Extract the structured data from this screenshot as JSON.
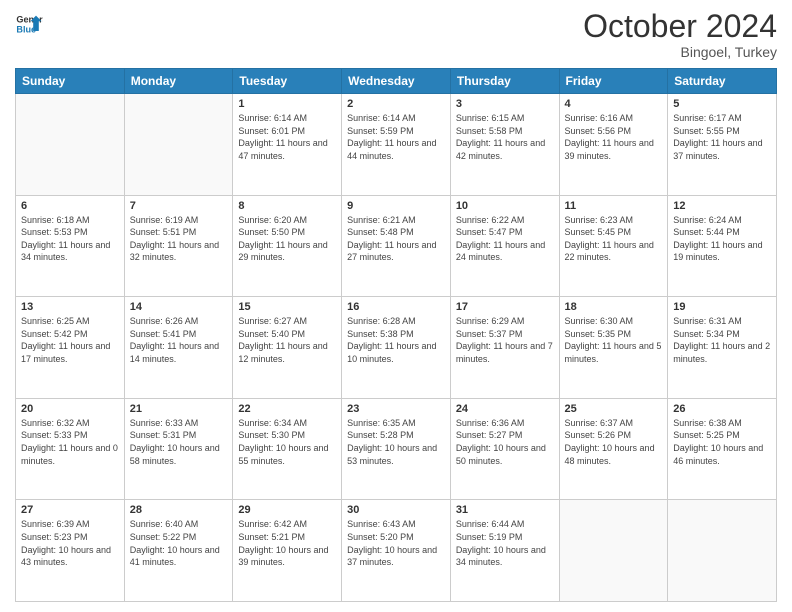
{
  "header": {
    "logo_line1": "General",
    "logo_line2": "Blue",
    "month": "October 2024",
    "location": "Bingoel, Turkey"
  },
  "weekdays": [
    "Sunday",
    "Monday",
    "Tuesday",
    "Wednesday",
    "Thursday",
    "Friday",
    "Saturday"
  ],
  "weeks": [
    [
      {
        "day": "",
        "sunrise": "",
        "sunset": "",
        "daylight": ""
      },
      {
        "day": "",
        "sunrise": "",
        "sunset": "",
        "daylight": ""
      },
      {
        "day": "1",
        "sunrise": "Sunrise: 6:14 AM",
        "sunset": "Sunset: 6:01 PM",
        "daylight": "Daylight: 11 hours and 47 minutes."
      },
      {
        "day": "2",
        "sunrise": "Sunrise: 6:14 AM",
        "sunset": "Sunset: 5:59 PM",
        "daylight": "Daylight: 11 hours and 44 minutes."
      },
      {
        "day": "3",
        "sunrise": "Sunrise: 6:15 AM",
        "sunset": "Sunset: 5:58 PM",
        "daylight": "Daylight: 11 hours and 42 minutes."
      },
      {
        "day": "4",
        "sunrise": "Sunrise: 6:16 AM",
        "sunset": "Sunset: 5:56 PM",
        "daylight": "Daylight: 11 hours and 39 minutes."
      },
      {
        "day": "5",
        "sunrise": "Sunrise: 6:17 AM",
        "sunset": "Sunset: 5:55 PM",
        "daylight": "Daylight: 11 hours and 37 minutes."
      }
    ],
    [
      {
        "day": "6",
        "sunrise": "Sunrise: 6:18 AM",
        "sunset": "Sunset: 5:53 PM",
        "daylight": "Daylight: 11 hours and 34 minutes."
      },
      {
        "day": "7",
        "sunrise": "Sunrise: 6:19 AM",
        "sunset": "Sunset: 5:51 PM",
        "daylight": "Daylight: 11 hours and 32 minutes."
      },
      {
        "day": "8",
        "sunrise": "Sunrise: 6:20 AM",
        "sunset": "Sunset: 5:50 PM",
        "daylight": "Daylight: 11 hours and 29 minutes."
      },
      {
        "day": "9",
        "sunrise": "Sunrise: 6:21 AM",
        "sunset": "Sunset: 5:48 PM",
        "daylight": "Daylight: 11 hours and 27 minutes."
      },
      {
        "day": "10",
        "sunrise": "Sunrise: 6:22 AM",
        "sunset": "Sunset: 5:47 PM",
        "daylight": "Daylight: 11 hours and 24 minutes."
      },
      {
        "day": "11",
        "sunrise": "Sunrise: 6:23 AM",
        "sunset": "Sunset: 5:45 PM",
        "daylight": "Daylight: 11 hours and 22 minutes."
      },
      {
        "day": "12",
        "sunrise": "Sunrise: 6:24 AM",
        "sunset": "Sunset: 5:44 PM",
        "daylight": "Daylight: 11 hours and 19 minutes."
      }
    ],
    [
      {
        "day": "13",
        "sunrise": "Sunrise: 6:25 AM",
        "sunset": "Sunset: 5:42 PM",
        "daylight": "Daylight: 11 hours and 17 minutes."
      },
      {
        "day": "14",
        "sunrise": "Sunrise: 6:26 AM",
        "sunset": "Sunset: 5:41 PM",
        "daylight": "Daylight: 11 hours and 14 minutes."
      },
      {
        "day": "15",
        "sunrise": "Sunrise: 6:27 AM",
        "sunset": "Sunset: 5:40 PM",
        "daylight": "Daylight: 11 hours and 12 minutes."
      },
      {
        "day": "16",
        "sunrise": "Sunrise: 6:28 AM",
        "sunset": "Sunset: 5:38 PM",
        "daylight": "Daylight: 11 hours and 10 minutes."
      },
      {
        "day": "17",
        "sunrise": "Sunrise: 6:29 AM",
        "sunset": "Sunset: 5:37 PM",
        "daylight": "Daylight: 11 hours and 7 minutes."
      },
      {
        "day": "18",
        "sunrise": "Sunrise: 6:30 AM",
        "sunset": "Sunset: 5:35 PM",
        "daylight": "Daylight: 11 hours and 5 minutes."
      },
      {
        "day": "19",
        "sunrise": "Sunrise: 6:31 AM",
        "sunset": "Sunset: 5:34 PM",
        "daylight": "Daylight: 11 hours and 2 minutes."
      }
    ],
    [
      {
        "day": "20",
        "sunrise": "Sunrise: 6:32 AM",
        "sunset": "Sunset: 5:33 PM",
        "daylight": "Daylight: 11 hours and 0 minutes."
      },
      {
        "day": "21",
        "sunrise": "Sunrise: 6:33 AM",
        "sunset": "Sunset: 5:31 PM",
        "daylight": "Daylight: 10 hours and 58 minutes."
      },
      {
        "day": "22",
        "sunrise": "Sunrise: 6:34 AM",
        "sunset": "Sunset: 5:30 PM",
        "daylight": "Daylight: 10 hours and 55 minutes."
      },
      {
        "day": "23",
        "sunrise": "Sunrise: 6:35 AM",
        "sunset": "Sunset: 5:28 PM",
        "daylight": "Daylight: 10 hours and 53 minutes."
      },
      {
        "day": "24",
        "sunrise": "Sunrise: 6:36 AM",
        "sunset": "Sunset: 5:27 PM",
        "daylight": "Daylight: 10 hours and 50 minutes."
      },
      {
        "day": "25",
        "sunrise": "Sunrise: 6:37 AM",
        "sunset": "Sunset: 5:26 PM",
        "daylight": "Daylight: 10 hours and 48 minutes."
      },
      {
        "day": "26",
        "sunrise": "Sunrise: 6:38 AM",
        "sunset": "Sunset: 5:25 PM",
        "daylight": "Daylight: 10 hours and 46 minutes."
      }
    ],
    [
      {
        "day": "27",
        "sunrise": "Sunrise: 6:39 AM",
        "sunset": "Sunset: 5:23 PM",
        "daylight": "Daylight: 10 hours and 43 minutes."
      },
      {
        "day": "28",
        "sunrise": "Sunrise: 6:40 AM",
        "sunset": "Sunset: 5:22 PM",
        "daylight": "Daylight: 10 hours and 41 minutes."
      },
      {
        "day": "29",
        "sunrise": "Sunrise: 6:42 AM",
        "sunset": "Sunset: 5:21 PM",
        "daylight": "Daylight: 10 hours and 39 minutes."
      },
      {
        "day": "30",
        "sunrise": "Sunrise: 6:43 AM",
        "sunset": "Sunset: 5:20 PM",
        "daylight": "Daylight: 10 hours and 37 minutes."
      },
      {
        "day": "31",
        "sunrise": "Sunrise: 6:44 AM",
        "sunset": "Sunset: 5:19 PM",
        "daylight": "Daylight: 10 hours and 34 minutes."
      },
      {
        "day": "",
        "sunrise": "",
        "sunset": "",
        "daylight": ""
      },
      {
        "day": "",
        "sunrise": "",
        "sunset": "",
        "daylight": ""
      }
    ]
  ]
}
